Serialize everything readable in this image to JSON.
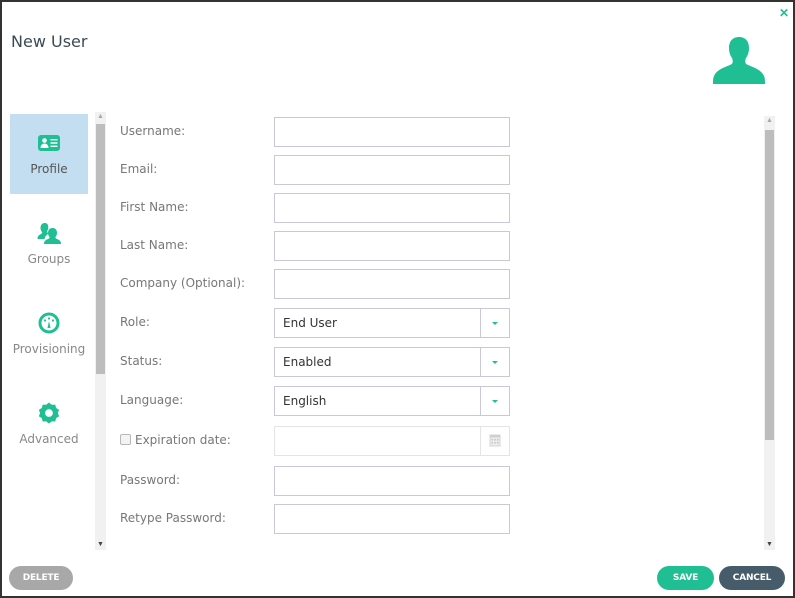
{
  "dialog": {
    "title": "New User",
    "close_icon": "close-icon",
    "avatar_icon": "user-silhouette-icon"
  },
  "nav": {
    "items": [
      {
        "label": "Profile",
        "icon": "id-card-icon",
        "active": true
      },
      {
        "label": "Groups",
        "icon": "users-icon",
        "active": false
      },
      {
        "label": "Provisioning",
        "icon": "gauge-icon",
        "active": false
      },
      {
        "label": "Advanced",
        "icon": "gear-icon",
        "active": false
      }
    ]
  },
  "form": {
    "fields": [
      {
        "label": "Username:",
        "type": "text",
        "value": ""
      },
      {
        "label": "Email:",
        "type": "text",
        "value": ""
      },
      {
        "label": "First Name:",
        "type": "text",
        "value": ""
      },
      {
        "label": "Last Name:",
        "type": "text",
        "value": ""
      },
      {
        "label": "Company (Optional):",
        "type": "text",
        "value": ""
      },
      {
        "label": "Role:",
        "type": "select",
        "value": "End User"
      },
      {
        "label": "Status:",
        "type": "select",
        "value": "Enabled"
      },
      {
        "label": "Language:",
        "type": "select",
        "value": "English"
      },
      {
        "label": "Expiration date:",
        "type": "date",
        "value": "",
        "checked": false
      },
      {
        "label": "Password:",
        "type": "password",
        "value": ""
      },
      {
        "label": "Retype Password:",
        "type": "password",
        "value": ""
      }
    ]
  },
  "footer": {
    "delete_label": "DELETE",
    "save_label": "SAVE",
    "cancel_label": "CANCEL"
  },
  "colors": {
    "accent": "#1fbf93",
    "active_nav_bg": "#c3def1",
    "cancel_bg": "#465c6a",
    "delete_bg": "#a8a8a8"
  }
}
